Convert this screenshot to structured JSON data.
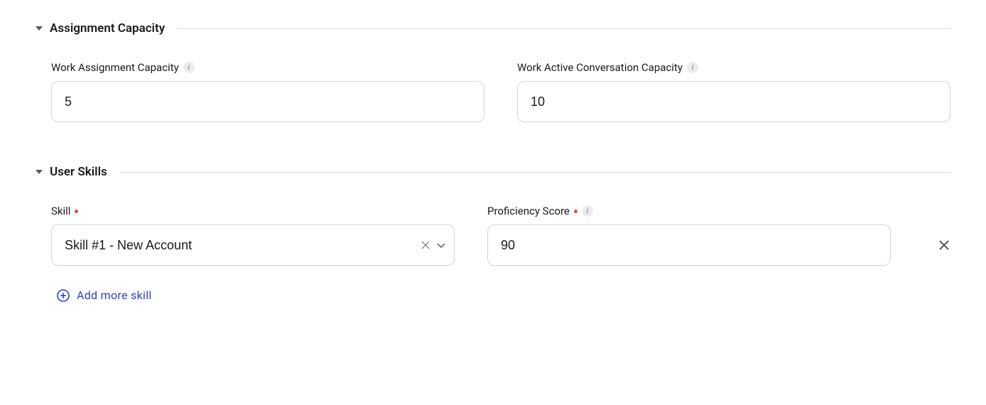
{
  "sections": {
    "assignment_capacity": {
      "title": "Assignment Capacity",
      "fields": {
        "work_assignment_capacity": {
          "label": "Work Assignment Capacity",
          "value": "5"
        },
        "work_active_conversation_capacity": {
          "label": "Work Active Conversation Capacity",
          "value": "10"
        }
      }
    },
    "user_skills": {
      "title": "User Skills",
      "fields": {
        "skill": {
          "label": "Skill",
          "value": "Skill #1 - New Account"
        },
        "proficiency_score": {
          "label": "Proficiency Score",
          "value": "90"
        }
      },
      "add_more_label": "Add more skill"
    }
  }
}
